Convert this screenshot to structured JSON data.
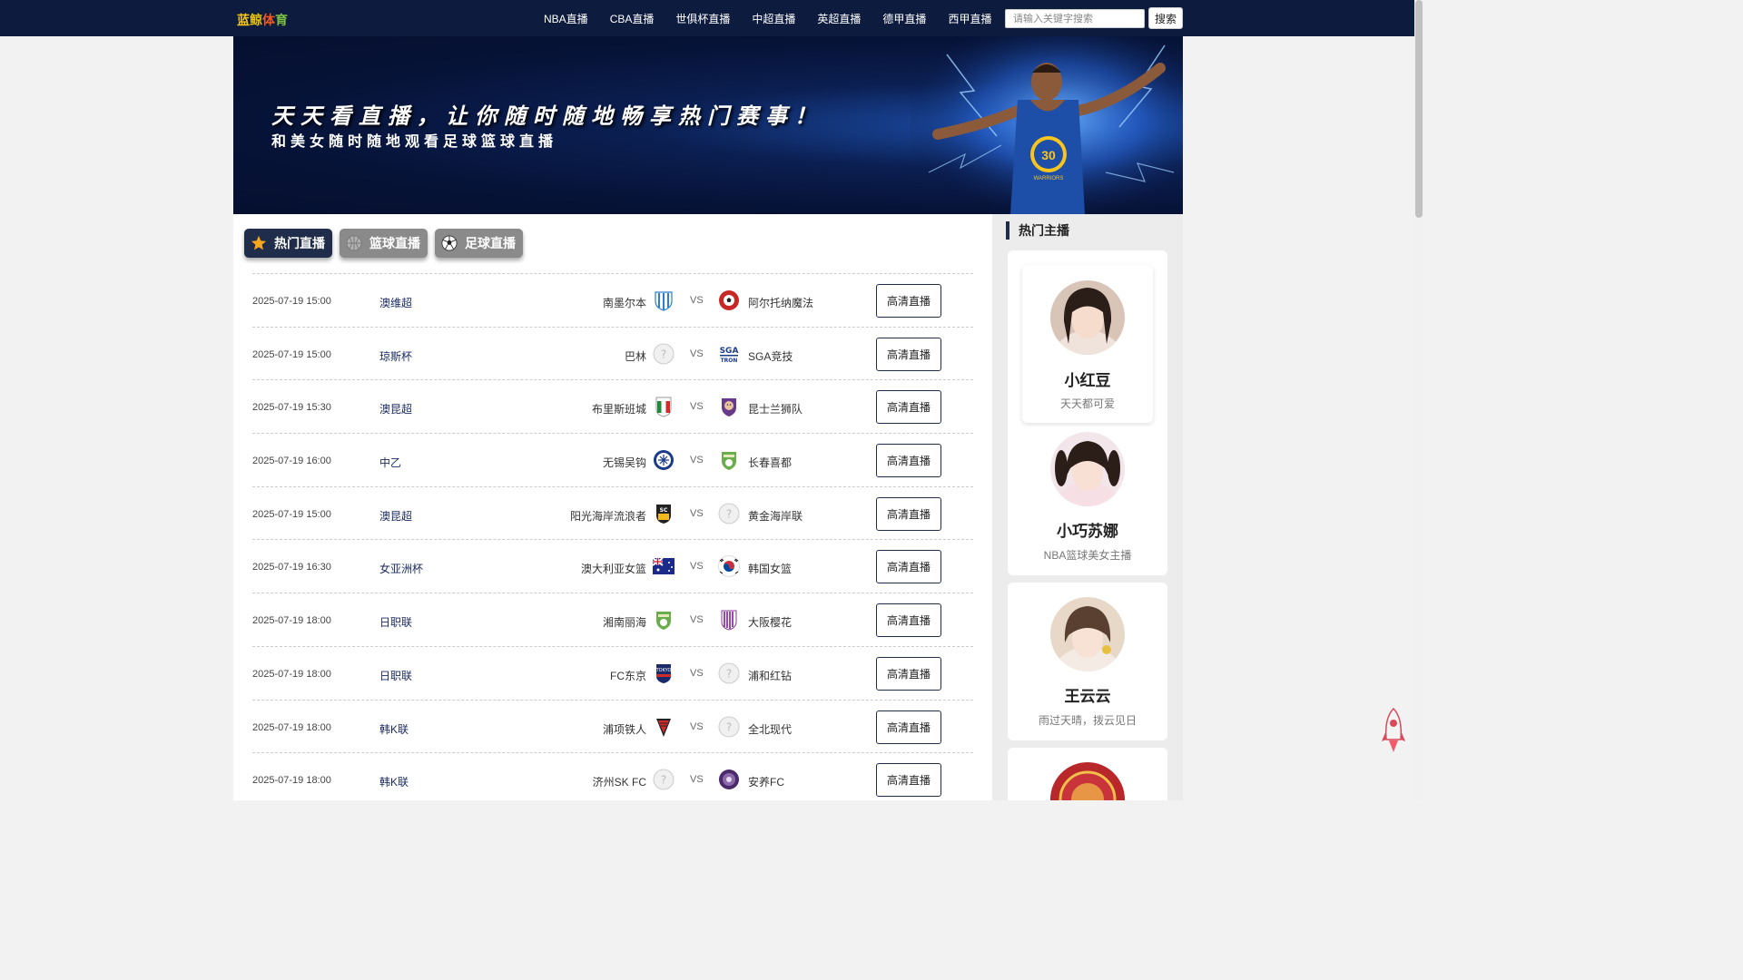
{
  "brand": {
    "logo_chars": [
      "蓝",
      "鲸",
      "体",
      "育"
    ],
    "logo_colors": [
      "#f5c518",
      "#e8c010",
      "#f25a1c",
      "#7bc043"
    ]
  },
  "nav": {
    "items": [
      "NBA直播",
      "CBA直播",
      "世俱杯直播",
      "中超直播",
      "英超直播",
      "德甲直播",
      "西甲直播"
    ]
  },
  "search": {
    "placeholder": "请输入关键字搜索",
    "button": "搜索"
  },
  "banner": {
    "headline": "天天看直播，让你随时随地畅享热门赛事！",
    "subline": "和美女随时随地观看足球篮球直播",
    "jersey_number": "30",
    "jersey_text": "WARRIORS"
  },
  "tabs": [
    {
      "label": "热门直播",
      "active": true,
      "icon": "star-icon"
    },
    {
      "label": "篮球直播",
      "active": false,
      "icon": "basketball-icon"
    },
    {
      "label": "足球直播",
      "active": false,
      "icon": "soccer-ball-icon"
    }
  ],
  "matches": [
    {
      "time": "2025-07-19 15:00",
      "league": "澳维超",
      "home": "南墨尔本",
      "vs": "VS",
      "away": "阿尔托纳魔法",
      "button": "高清直播",
      "home_logo": "blue-stripe-crest",
      "away_logo": "red-ball-crest"
    },
    {
      "time": "2025-07-19 15:00",
      "league": "琼斯杯",
      "home": "巴林",
      "vs": "VS",
      "away": "SGA竞技",
      "button": "高清直播",
      "home_logo": "placeholder",
      "away_logo": "sga-tron"
    },
    {
      "time": "2025-07-19 15:30",
      "league": "澳昆超",
      "home": "布里斯班城",
      "vs": "VS",
      "away": "昆士兰狮队",
      "button": "高清直播",
      "home_logo": "italy-crest",
      "away_logo": "purple-lion"
    },
    {
      "time": "2025-07-19 16:00",
      "league": "中乙",
      "home": "无锡吴钩",
      "vs": "VS",
      "away": "长春喜都",
      "button": "高清直播",
      "home_logo": "blue-round",
      "away_logo": "green-crest"
    },
    {
      "time": "2025-07-19 15:00",
      "league": "澳昆超",
      "home": "阳光海岸流浪者",
      "vs": "VS",
      "away": "黄金海岸联",
      "button": "高清直播",
      "home_logo": "yellow-crest",
      "away_logo": "placeholder"
    },
    {
      "time": "2025-07-19 16:30",
      "league": "女亚洲杯",
      "home": "澳大利亚女篮",
      "vs": "VS",
      "away": "韩国女篮",
      "button": "高清直播",
      "home_logo": "australia-flag",
      "away_logo": "korea-flag"
    },
    {
      "time": "2025-07-19 18:00",
      "league": "日职联",
      "home": "湘南丽海",
      "vs": "VS",
      "away": "大阪樱花",
      "button": "高清直播",
      "home_logo": "green-crest",
      "away_logo": "purple-stripe-crest"
    },
    {
      "time": "2025-07-19 18:00",
      "league": "日职联",
      "home": "FC东京",
      "vs": "VS",
      "away": "浦和红钻",
      "button": "高清直播",
      "home_logo": "fc-tokyo-crest",
      "away_logo": "placeholder"
    },
    {
      "time": "2025-07-19 18:00",
      "league": "韩K联",
      "home": "浦项铁人",
      "vs": "VS",
      "away": "全北现代",
      "button": "高清直播",
      "home_logo": "pohang-crest",
      "away_logo": "placeholder"
    },
    {
      "time": "2025-07-19 18:00",
      "league": "韩K联",
      "home": "济州SK FC",
      "vs": "VS",
      "away": "安养FC",
      "button": "高清直播",
      "home_logo": "placeholder",
      "away_logo": "anyang-crest"
    }
  ],
  "sidebar": {
    "title": "热门主播",
    "anchors": [
      {
        "name": "小红豆",
        "desc": "天天都可爱"
      },
      {
        "name": "小巧苏娜",
        "desc": "NBA篮球美女主播"
      },
      {
        "name": "王云云",
        "desc": "雨过天晴，拨云见日"
      },
      {
        "name": "",
        "desc": ""
      }
    ]
  },
  "colors": {
    "nav_bg": "#0d1b3e",
    "accent": "#1f2d4a",
    "tab_inactive": "#8a8a8a"
  }
}
